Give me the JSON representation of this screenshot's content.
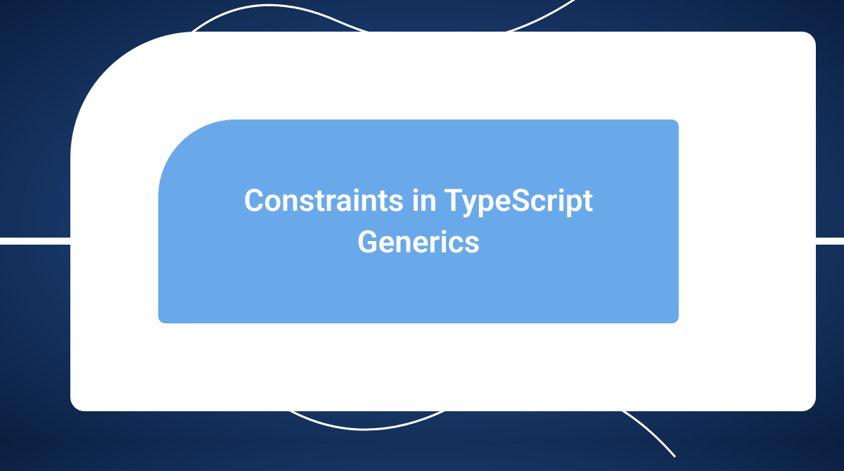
{
  "banner": {
    "title": "Constraints in TypeScript Generics"
  }
}
